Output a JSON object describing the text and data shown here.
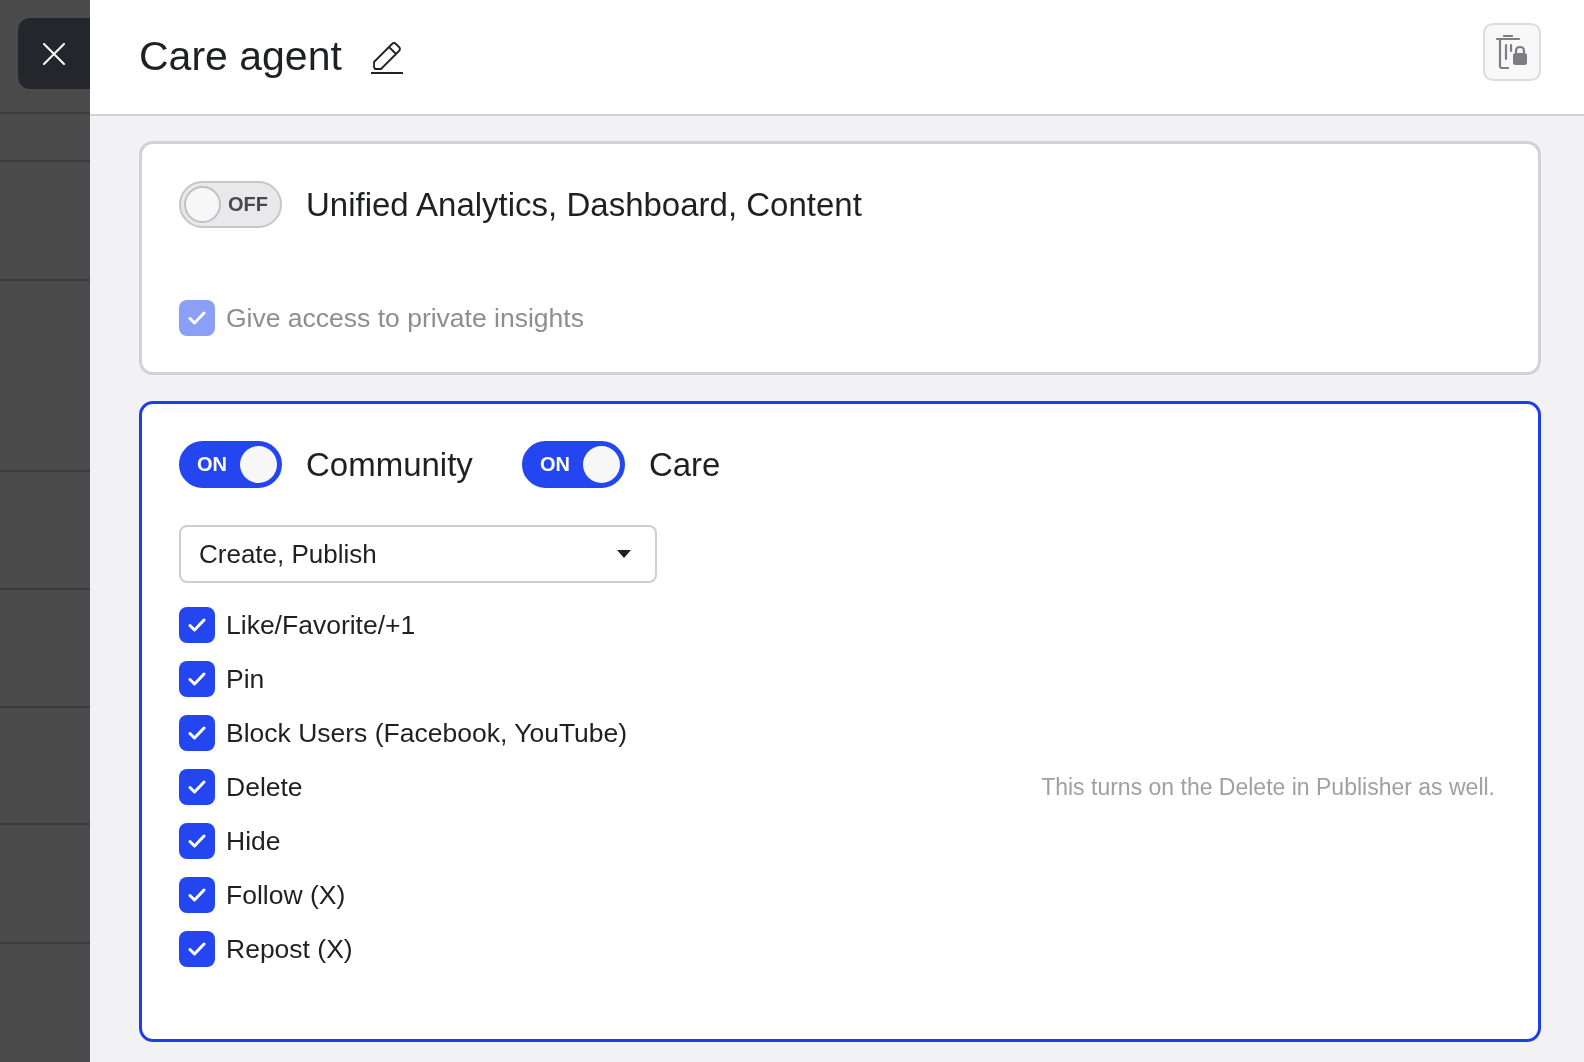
{
  "drawer": {
    "title": "Care agent",
    "sections": [
      {
        "selected": false,
        "toggles": [
          {
            "state_text": "OFF",
            "on": false,
            "label": "Unified Analytics, Dashboard, Content"
          }
        ],
        "checkboxes": [
          {
            "label": "Give access to private insights",
            "checked": true,
            "disabled": true
          }
        ]
      },
      {
        "selected": true,
        "toggles": [
          {
            "state_text": "ON",
            "on": true,
            "label": "Community"
          },
          {
            "state_text": "ON",
            "on": true,
            "label": "Care"
          }
        ],
        "dropdown": {
          "value": "Create, Publish"
        },
        "checkboxes": [
          {
            "label": "Like/Favorite/+1",
            "checked": true,
            "disabled": false
          },
          {
            "label": "Pin",
            "checked": true,
            "disabled": false
          },
          {
            "label": "Block Users (Facebook, YouTube)",
            "checked": true,
            "disabled": false
          },
          {
            "label": "Delete",
            "checked": true,
            "disabled": false,
            "note": "This turns on the Delete in Publisher as well."
          },
          {
            "label": "Hide",
            "checked": true,
            "disabled": false
          },
          {
            "label": "Follow (X)",
            "checked": true,
            "disabled": false
          },
          {
            "label": "Repost (X)",
            "checked": true,
            "disabled": false
          }
        ]
      }
    ]
  }
}
